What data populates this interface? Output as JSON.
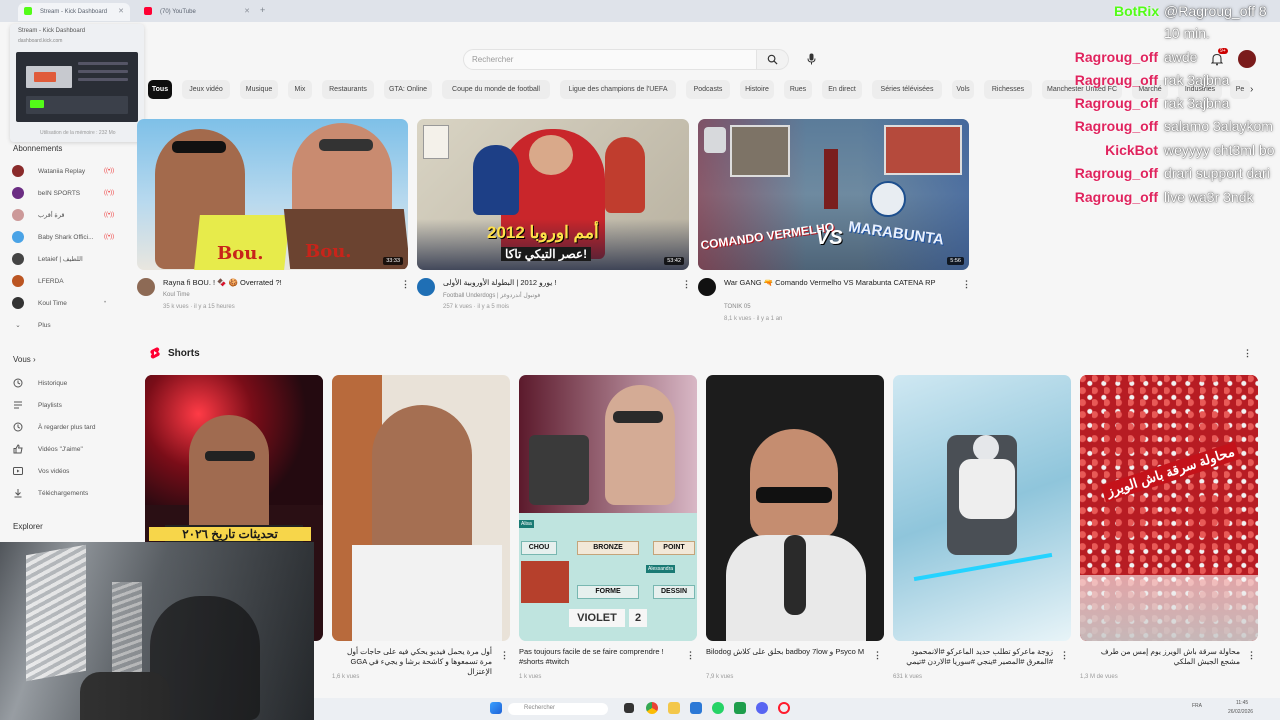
{
  "browser": {
    "tabs": [
      {
        "title": "Stream - Kick Dashboard",
        "color": "#53fc18"
      },
      {
        "title": "(70) YouTube",
        "color": "#ff0033"
      }
    ],
    "preview": {
      "title": "Stream - Kick Dashboard",
      "url": "dashboard.kick.com",
      "memory": "Utilisation de la mémoire : 232 Mo"
    }
  },
  "header": {
    "search_placeholder": "Rechercher",
    "notif_count": "9+"
  },
  "chips": [
    "Tous",
    "Jeux vidéo",
    "Musique",
    "Mix",
    "Restaurants",
    "GTA: Online",
    "Coupe du monde de football",
    "Ligue des champions de l'UEFA",
    "Podcasts",
    "Histoire",
    "Rues",
    "En direct",
    "Séries télévisées",
    "Vols",
    "Richesses",
    "Manchester United FC",
    "Marché",
    "Industries",
    "Pe"
  ],
  "sidebar": {
    "subs_header": "Abonnements",
    "subs": [
      {
        "name": "Wataniia Replay",
        "live": true,
        "color": "#8a2b2b"
      },
      {
        "name": "beIN SPORTS",
        "live": true,
        "color": "#6b2d83"
      },
      {
        "name": "قرة أقرب",
        "live": true,
        "color": "#c99"
      },
      {
        "name": "Baby Shark Offici...",
        "live": true,
        "color": "#4aa3e6"
      },
      {
        "name": "Letaief | اللطيف",
        "live": false,
        "color": "#444"
      },
      {
        "name": "LFERDA",
        "live": false,
        "color": "#b52"
      },
      {
        "name": "Koul Time",
        "live": false,
        "color": "#333"
      }
    ],
    "more": "Plus",
    "you_header": "Vous",
    "you_items": [
      {
        "label": "Historique",
        "icon": "history-icon"
      },
      {
        "label": "Playlists",
        "icon": "playlist-icon"
      },
      {
        "label": "À regarder plus tard",
        "icon": "clock-icon"
      },
      {
        "label": "Vidéos \"J'aime\"",
        "icon": "thumb-up-icon"
      },
      {
        "label": "Vos vidéos",
        "icon": "play-square-icon"
      },
      {
        "label": "Téléchargements",
        "icon": "download-icon"
      }
    ],
    "explore_header": "Explorer"
  },
  "videos": [
    {
      "title": "Rayna fi BOU. ! 🍫 🍪 Overrated ?!",
      "channel": "Koul Time",
      "stats": "35 k vues · il y a 15 heures",
      "duration": "33:33"
    },
    {
      "title": "يورو 2012 | البطولة الأوروبية الأولى !",
      "channel": "Football Underdogs | فوتبول أندردوغز",
      "stats": "257 k vues · il y a 5 mois",
      "duration": "53:42"
    },
    {
      "title": "War GANG 🔫 Comando Vermelho VS Marabunta CATENA RP",
      "channel": "TONIK 05",
      "stats": "8,1 k vues · il y a 1 an",
      "duration": "5:56"
    }
  ],
  "shorts_header": "Shorts",
  "shorts": [
    {
      "title": "أول مرة يحمل فيديو يحكي فيه على حاجات أول GGA مرة تسمعوها و كاشحة برشا و يجيء في الإعتزال",
      "views": "1,6 k vues"
    },
    {
      "title": "",
      "views": ""
    },
    {
      "title": "Pas toujours facile de se faire comprendre ! #shorts #twitch",
      "views": "1 k vues"
    },
    {
      "title": "Bilodog بحلق على كلاش badboy 7low و Psyco M",
      "views": "7,9 k vues"
    },
    {
      "title": "زوجة ماعركو تطلب حديد الماعركو #الانمحمود #المعرق #المصير #ينجي #سوريا #الاردن #تيمي",
      "views": "631 k vues"
    },
    {
      "title": "محاولة سرقة باش الويرز يوم إمس من طرف مشجع الجيش الملكي",
      "views": "1,3 M de vues"
    }
  ],
  "short_text": {
    "s1_banner": "تحديثات تاريخ ٢٠٢٦",
    "s3_words": [
      "CHOU",
      "BRONZE",
      "POINT",
      "FORME",
      "DESSIN"
    ],
    "s3_violet": "VIOLET",
    "s3_num": "2",
    "s3_tag1": "Alisa",
    "s3_tag2": "Alessandra",
    "s6_banner": "محاولة سرقة باش الويرز"
  },
  "thumb_text": {
    "v1_bou": "Bou.",
    "v2_headline": "أمم اوروبا 2012",
    "v2_sub": "عصر التيكي تاكا!",
    "v3_a": "COMANDO VERMELHO",
    "v3_vs": "VS",
    "v3_b": "MARABUNTA"
  },
  "chat": [
    {
      "user": "BotRix",
      "msg": "@Ragroug_off 8",
      "color": "#53fc18"
    },
    {
      "user": "",
      "msg": "10 min.",
      "color": "#53fc18"
    },
    {
      "user": "Ragroug_off",
      "msg": "awde",
      "color": "#e0245e"
    },
    {
      "user": "Ragroug_off",
      "msg": "rak 3ajbna",
      "color": "#e0245e"
    },
    {
      "user": "Ragroug_off",
      "msg": "rak 3ajbna",
      "color": "#e0245e"
    },
    {
      "user": "Ragroug_off",
      "msg": "salamo 3alaykom",
      "color": "#e0245e"
    },
    {
      "user": "KickBot",
      "msg": "weyyyy cht3ml bo",
      "color": "#e0245e"
    },
    {
      "user": "Ragroug_off",
      "msg": "drari support dari",
      "color": "#e0245e"
    },
    {
      "user": "Ragroug_off",
      "msg": "live wa3r 3ndk",
      "color": "#e0245e"
    }
  ],
  "taskbar": {
    "search": "Rechercher",
    "lang": "FRA",
    "time": "11:45",
    "date": "26/02/2026"
  }
}
